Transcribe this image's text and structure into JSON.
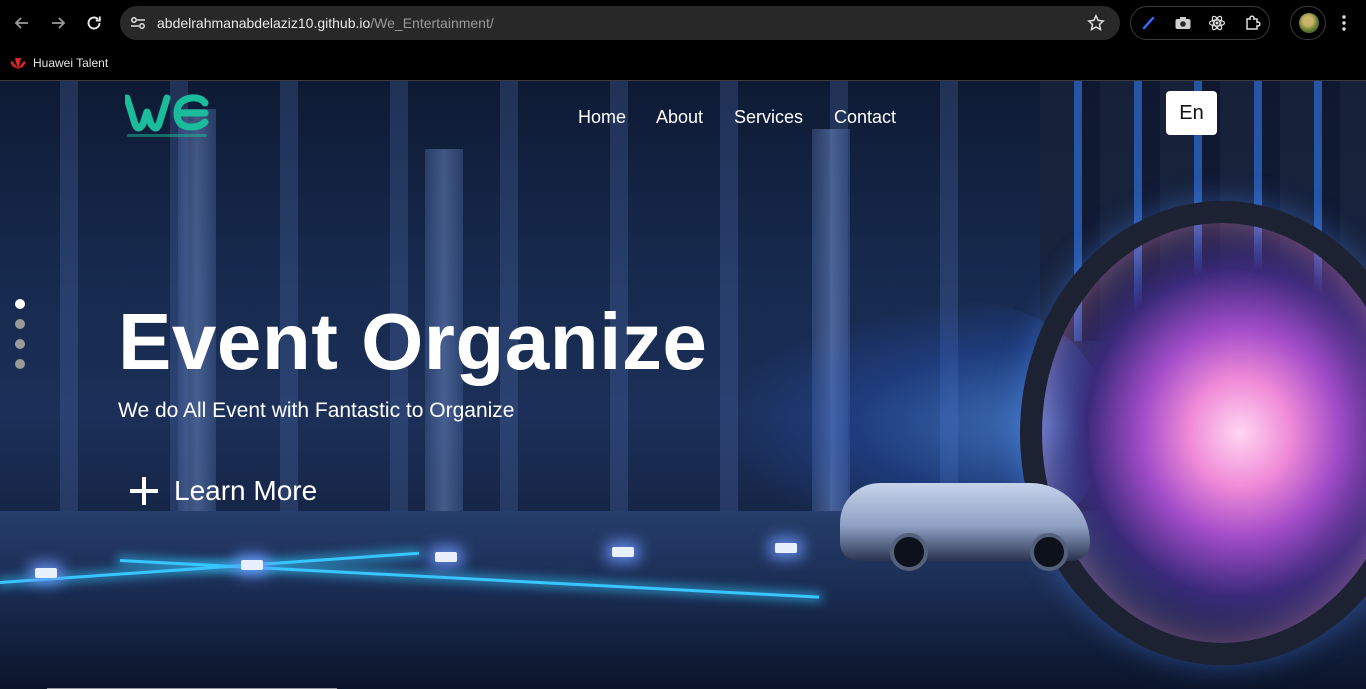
{
  "browser": {
    "url_host": "abdelrahmanabdelaziz10.github.io",
    "url_path": "/We_Entertainment/",
    "bookmarks": [
      {
        "label": "Huawei Talent",
        "icon": "huawei-logo-icon"
      }
    ],
    "icons": {
      "back": "arrow-left-icon",
      "forward": "arrow-right-icon",
      "reload": "reload-icon",
      "site_info": "tune-icon",
      "bookmark_star": "star-icon",
      "extensions": [
        "ink-pen-icon",
        "camera-icon",
        "react-atom-icon",
        "puzzle-icon"
      ],
      "menu": "kebab-menu-icon"
    }
  },
  "site": {
    "logo_text": "WE",
    "nav": [
      {
        "label": "Home"
      },
      {
        "label": "About"
      },
      {
        "label": "Services"
      },
      {
        "label": "Contact"
      }
    ],
    "language_button": "En",
    "hero": {
      "title": "Event Organize",
      "subtitle": "We do All Event with Fantastic to Organize",
      "cta_label": "Learn More",
      "cta_icon": "plus-icon",
      "slider_dots_count": 4,
      "active_dot_index": 0
    },
    "colors": {
      "logo_teal": "#1abc9c",
      "accent_white": "#ffffff",
      "cyan_light": "#37c6ff"
    }
  }
}
